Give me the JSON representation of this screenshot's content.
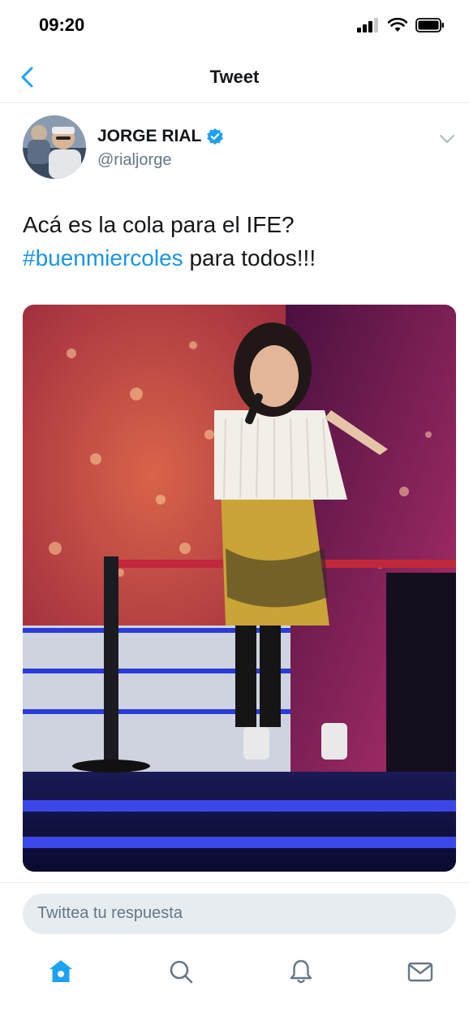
{
  "status_bar": {
    "time": "09:20"
  },
  "nav": {
    "title": "Tweet"
  },
  "tweet": {
    "author_name": "JORGE RIAL",
    "author_handle": "@rialjorge",
    "text_line1": "Acá es la cola para el IFE?",
    "hashtag": "#buenmiercoles",
    "text_after_hashtag": " para todos!!!"
  },
  "reply": {
    "placeholder": "Twittea tu respuesta"
  },
  "colors": {
    "accent": "#1da1f2",
    "hashtag": "#1b95e0",
    "secondary_text": "#657786"
  }
}
